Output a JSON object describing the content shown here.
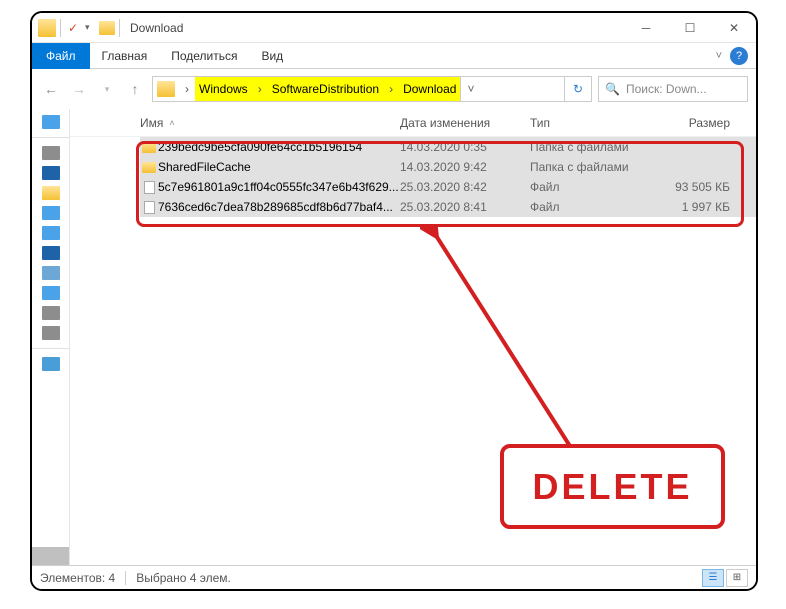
{
  "window": {
    "title": "Download"
  },
  "ribbon": {
    "file": "Файл",
    "tabs": [
      "Главная",
      "Поделиться",
      "Вид"
    ]
  },
  "breadcrumbs": [
    "Windows",
    "SoftwareDistribution",
    "Download"
  ],
  "search": {
    "placeholder": "Поиск: Down..."
  },
  "columns": {
    "name": "Имя",
    "date": "Дата изменения",
    "type": "Тип",
    "size": "Размер"
  },
  "rows": [
    {
      "icon": "folder",
      "name": "239bedc9be5cfa090fe64cc1b5196154",
      "date": "14.03.2020 0:35",
      "type": "Папка с файлами",
      "size": ""
    },
    {
      "icon": "folder",
      "name": "SharedFileCache",
      "date": "14.03.2020 9:42",
      "type": "Папка с файлами",
      "size": ""
    },
    {
      "icon": "file",
      "name": "5c7e961801a9c1ff04c0555fc347e6b43f629...",
      "date": "25.03.2020 8:42",
      "type": "Файл",
      "size": "93 505 КБ"
    },
    {
      "icon": "file",
      "name": "7636ced6c7dea78b289685cdf8b6d77baf4...",
      "date": "25.03.2020 8:41",
      "type": "Файл",
      "size": "1 997 КБ"
    }
  ],
  "status": {
    "count": "Элементов: 4",
    "selected": "Выбрано 4 элем."
  },
  "annotation": {
    "label": "DELETE"
  }
}
